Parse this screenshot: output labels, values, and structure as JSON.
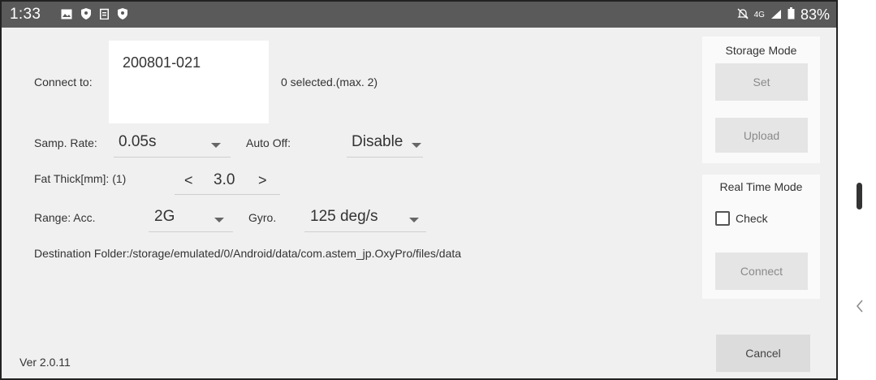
{
  "statusbar": {
    "time": "1:33",
    "network": "4G",
    "battery_percent": "83%",
    "left_icons": [
      "image-icon",
      "shield-icon",
      "clipboard-icon",
      "shield-icon"
    ],
    "right_icons": [
      "mute-icon",
      "signal-icon",
      "battery-icon"
    ]
  },
  "form": {
    "connect_label": "Connect to:",
    "device_id": "200801-021",
    "selected_text": "0 selected.(max. 2)",
    "samp_rate_label": "Samp. Rate:",
    "samp_rate_value": "0.05s",
    "auto_off_label": "Auto Off:",
    "auto_off_value": "Disable",
    "fat_thick_label": "Fat Thick[mm]: (1)",
    "fat_thick_prev": "<",
    "fat_thick_value": "3.0",
    "fat_thick_next": ">",
    "range_label": "Range: Acc.",
    "acc_value": "2G",
    "gyro_label": "Gyro.",
    "gyro_value": "125 deg/s",
    "destination_text": "Destination Folder:/storage/emulated/0/Android/data/com.astem_jp.OxyPro/files/data"
  },
  "version": "Ver 2.0.11",
  "storage_mode": {
    "title": "Storage Mode",
    "set_label": "Set",
    "upload_label": "Upload"
  },
  "real_time_mode": {
    "title": "Real Time Mode",
    "check_label": "Check",
    "checked": false,
    "connect_label": "Connect"
  },
  "cancel_label": "Cancel",
  "colors": {
    "statusbar": "#5a5a5a",
    "background": "#f0f0f0",
    "disabled_text": "#8a8a8a"
  }
}
